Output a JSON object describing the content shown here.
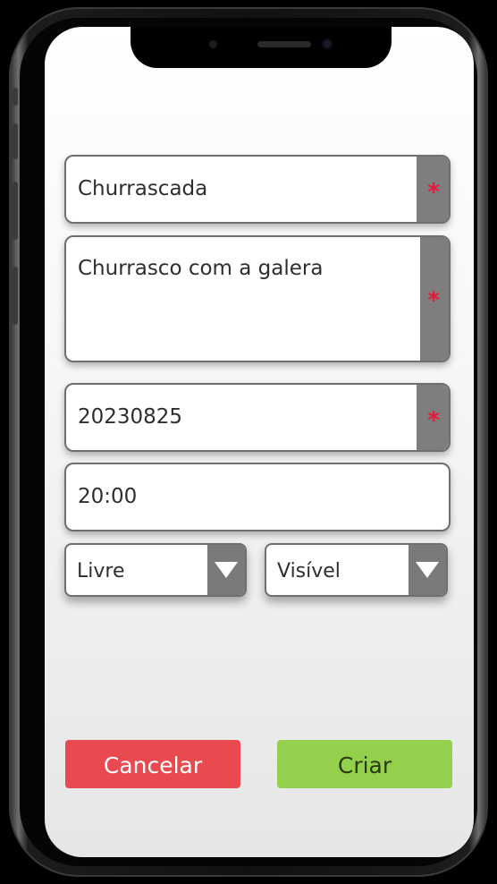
{
  "form": {
    "title_value": "Churrascada",
    "description_value": "Churrasco com a galera",
    "date_value": "20230825",
    "time_value": "20:00",
    "required_marker": "*"
  },
  "selects": {
    "access": {
      "selected": "Livre"
    },
    "visibility": {
      "selected": "Visível"
    }
  },
  "actions": {
    "cancel_label": "Cancelar",
    "create_label": "Criar"
  },
  "colors": {
    "cancel_bg": "#e84a4f",
    "create_bg": "#93d14c",
    "required_star": "#e8183a",
    "tab_gray": "#7e7e7e"
  },
  "icons": {
    "required": "asterisk-icon",
    "dropdown": "triangle-down-icon"
  }
}
